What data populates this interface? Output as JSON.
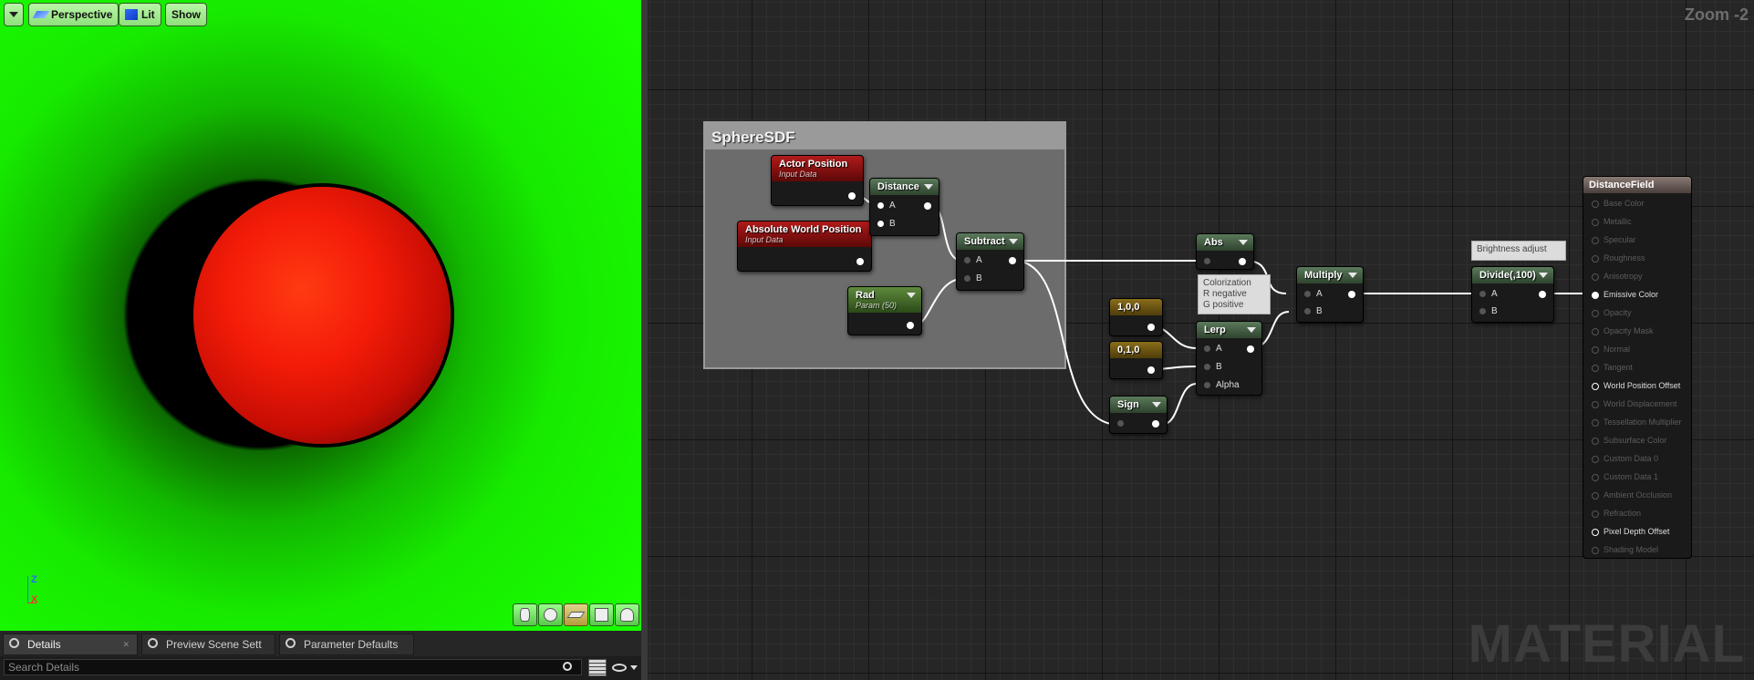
{
  "viewport": {
    "toolbar": {
      "perspective": "Perspective",
      "lit": "Lit",
      "show": "Show"
    },
    "axis": {
      "z": "Z",
      "x": "X"
    },
    "shapes": [
      "cylinder-icon",
      "sphere-icon",
      "plane-icon",
      "cube-icon",
      "custom-mesh-icon"
    ],
    "active_shape": "plane-icon",
    "background_color": "#19ff00",
    "sphere_color": "#ff2a10"
  },
  "panel": {
    "tabs": [
      {
        "label": "Details"
      },
      {
        "label": "Preview Scene Sett"
      },
      {
        "label": "Parameter Defaults"
      }
    ],
    "search": {
      "placeholder": "Search Details"
    }
  },
  "graph": {
    "zoom": "Zoom -2",
    "watermark": "MATERIAL",
    "comment": {
      "title": "SphereSDF"
    },
    "nodes": {
      "actor_position": {
        "title": "Actor Position",
        "subtitle": "Input Data"
      },
      "abs_world_position": {
        "title": "Absolute World Position",
        "subtitle": "Input Data"
      },
      "distance": {
        "title": "Distance",
        "pins": [
          "A",
          "B"
        ]
      },
      "rad": {
        "title": "Rad",
        "subtitle": "Param (50)"
      },
      "subtract": {
        "title": "Subtract",
        "pins": [
          "A",
          "B"
        ]
      },
      "abs": {
        "title": "Abs"
      },
      "const_100": {
        "title": "1,0,0"
      },
      "const_010": {
        "title": "0,1,0"
      },
      "sign": {
        "title": "Sign"
      },
      "lerp": {
        "title": "Lerp",
        "pins": [
          "A",
          "B",
          "Alpha"
        ]
      },
      "multiply": {
        "title": "Multiply",
        "pins": [
          "A",
          "B"
        ]
      },
      "divide": {
        "title": "Divide(,100)",
        "pins": [
          "A",
          "B"
        ]
      }
    },
    "comments_small": {
      "colorization": [
        "Colorization",
        "R negative",
        "G positive"
      ],
      "brightness": "Brightness adjust"
    },
    "result": {
      "title": "DistanceField",
      "pins": [
        {
          "label": "Base Color",
          "state": "dim"
        },
        {
          "label": "Metallic",
          "state": "dim"
        },
        {
          "label": "Specular",
          "state": "dim"
        },
        {
          "label": "Roughness",
          "state": "dim"
        },
        {
          "label": "Anisotropy",
          "state": "dim"
        },
        {
          "label": "Emissive Color",
          "state": "on"
        },
        {
          "label": "Opacity",
          "state": "dim"
        },
        {
          "label": "Opacity Mask",
          "state": "dim"
        },
        {
          "label": "Normal",
          "state": "dim"
        },
        {
          "label": "Tangent",
          "state": "dim"
        },
        {
          "label": "World Position Offset",
          "state": "hollow"
        },
        {
          "label": "World Displacement",
          "state": "dim"
        },
        {
          "label": "Tessellation Multiplier",
          "state": "dim"
        },
        {
          "label": "Subsurface Color",
          "state": "dim"
        },
        {
          "label": "Custom Data 0",
          "state": "dim"
        },
        {
          "label": "Custom Data 1",
          "state": "dim"
        },
        {
          "label": "Ambient Occlusion",
          "state": "dim"
        },
        {
          "label": "Refraction",
          "state": "dim"
        },
        {
          "label": "Pixel Depth Offset",
          "state": "hollow"
        },
        {
          "label": "Shading Model",
          "state": "dim"
        }
      ]
    }
  }
}
